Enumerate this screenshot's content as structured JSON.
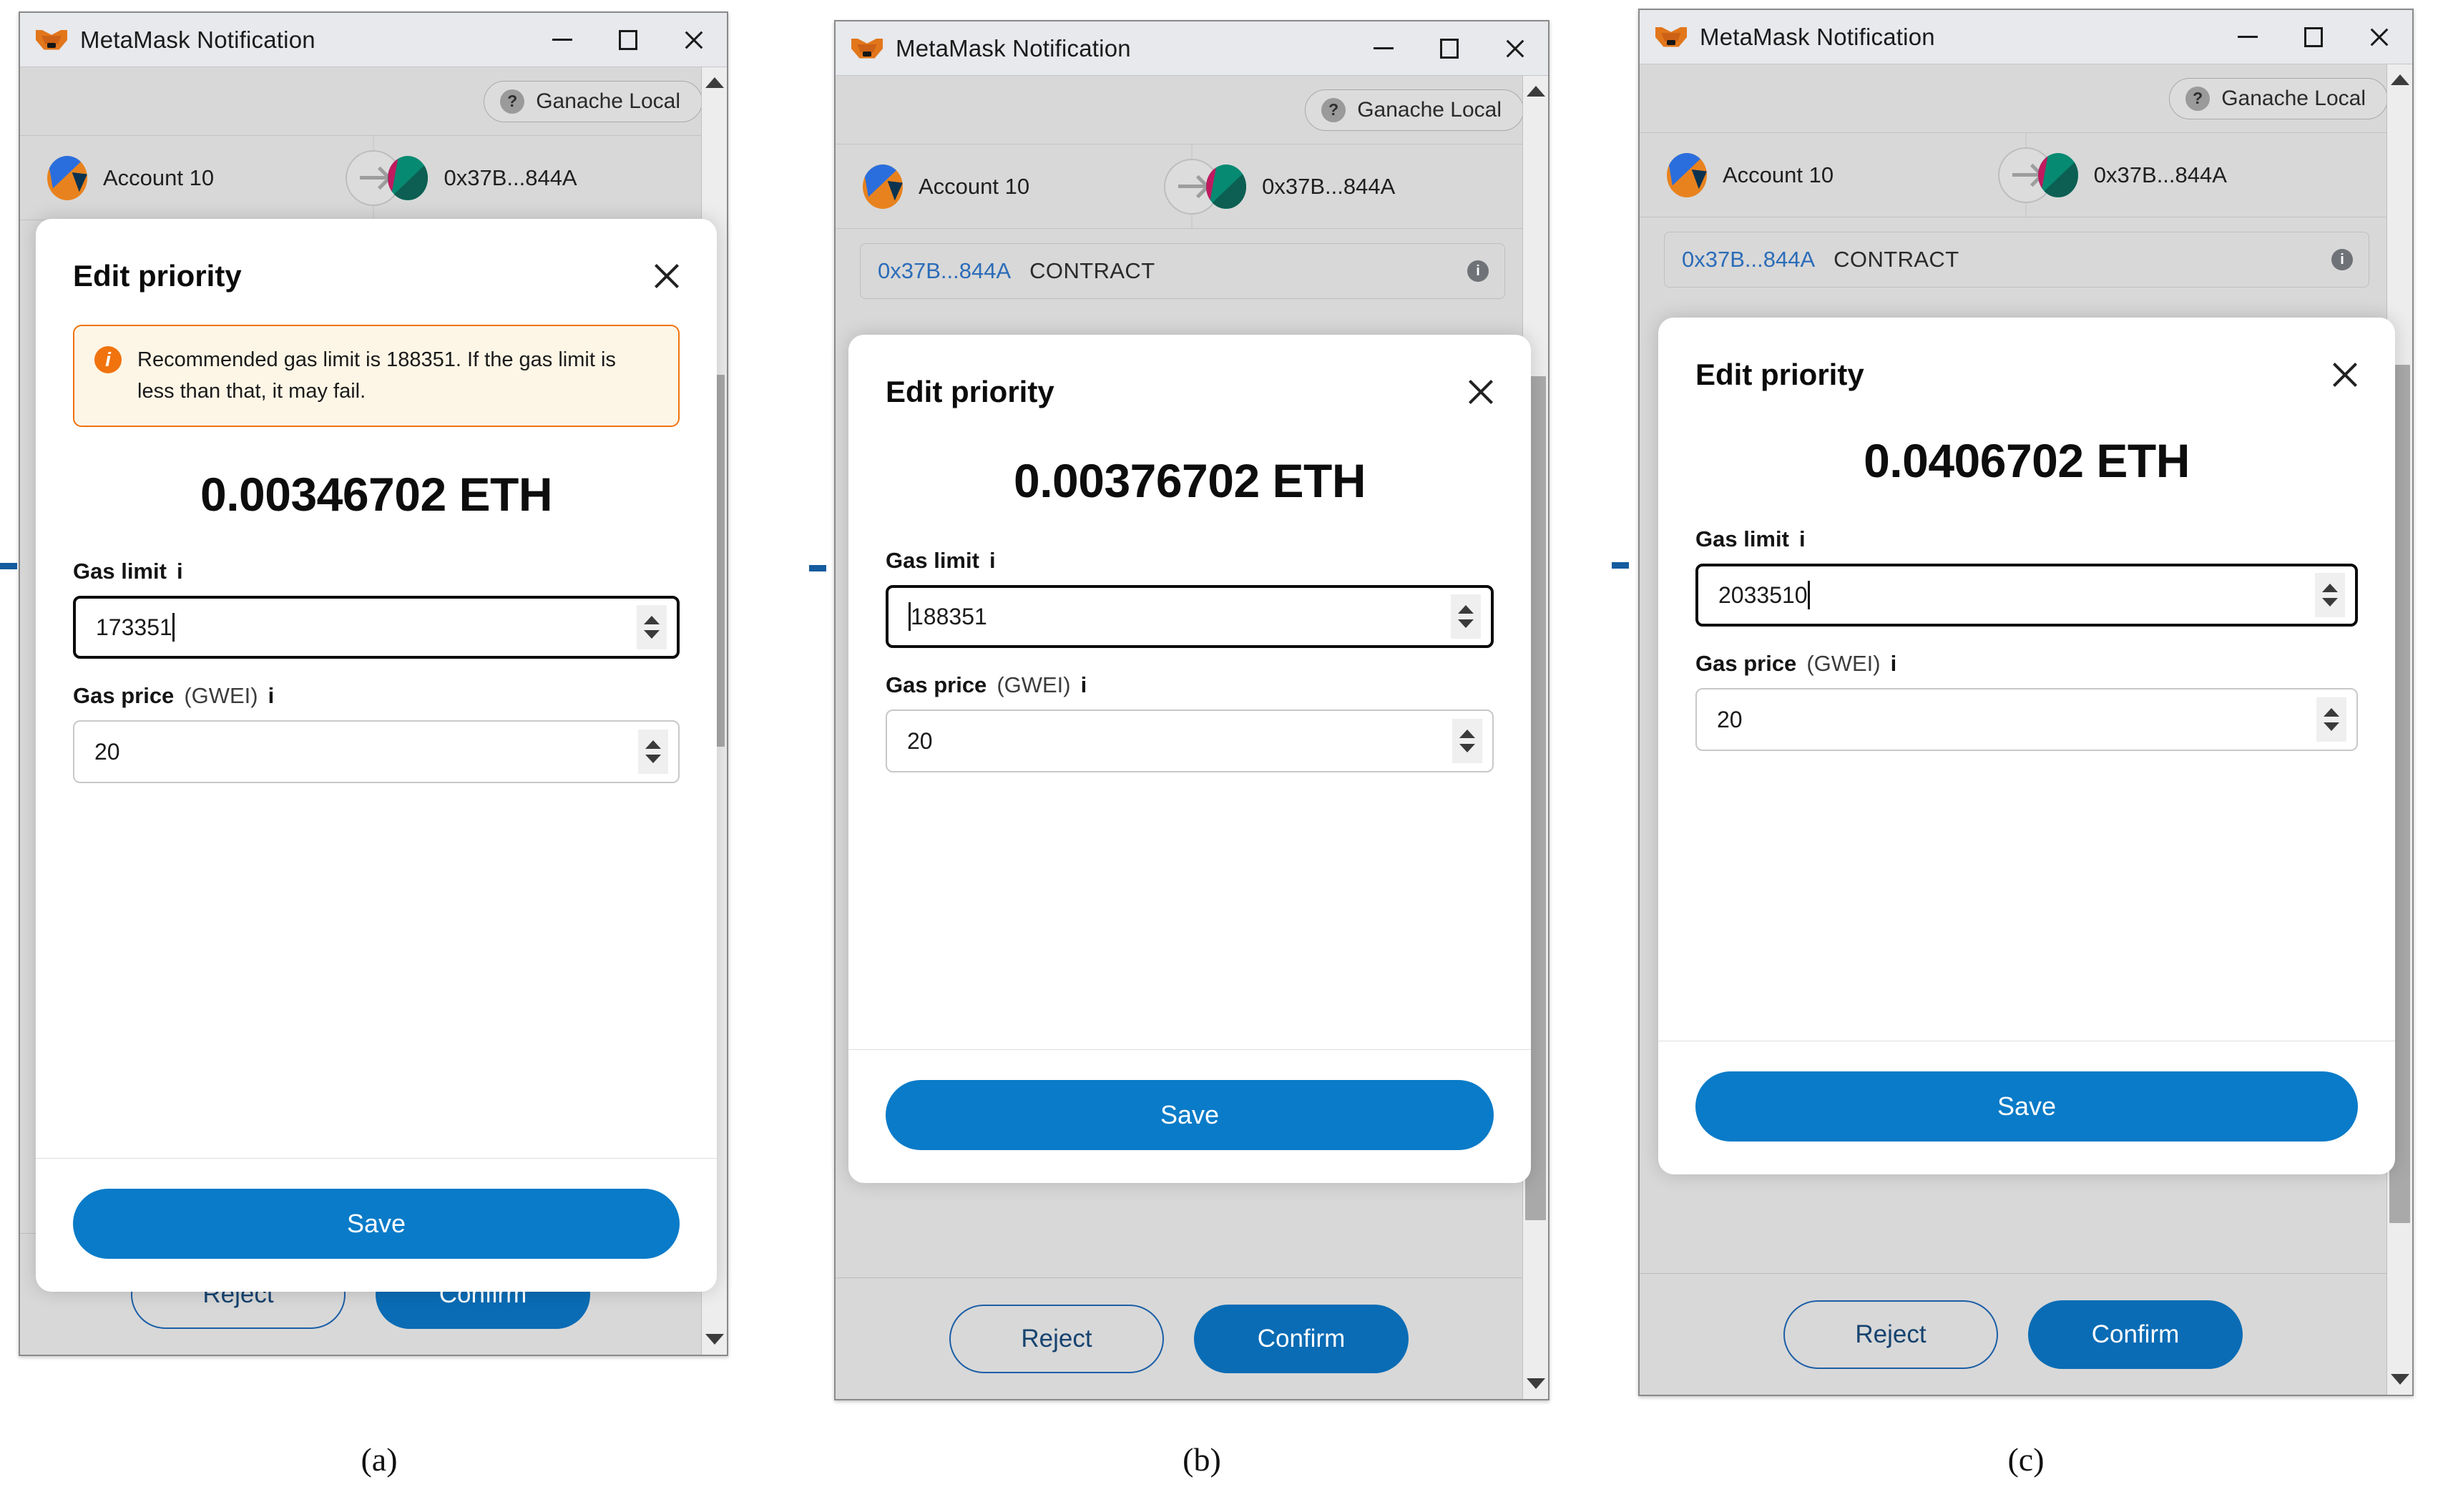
{
  "window": {
    "title": "MetaMask Notification",
    "minimize_label": "–",
    "maximize_label": "▢",
    "close_label": "✕"
  },
  "network": {
    "badge_icon": "question-mark-icon",
    "name": "Ganache Local"
  },
  "transfer": {
    "sender": "Account 10",
    "recipient": "0x37B...844A",
    "arrow_icon": "arrow-right-icon"
  },
  "contract_row": {
    "address": "0x37B...844A",
    "tag": "CONTRACT",
    "info_icon": "info-icon"
  },
  "footer": {
    "reject_label": "Reject",
    "confirm_label": "Confirm"
  },
  "modal": {
    "title": "Edit priority",
    "close_icon": "close-icon",
    "gas_limit_label": "Gas limit",
    "gas_price_label": "Gas price",
    "gas_price_unit": "(GWEI)",
    "info_icon": "info-icon",
    "save_label": "Save",
    "spinner_icon": "stepper-arrows-icon"
  },
  "panels": {
    "a": {
      "caption": "(a)",
      "alert": {
        "icon": "alert-info-icon",
        "text": "Recommended gas limit is 188351. If the gas limit is less than that, it may fail."
      },
      "eth_amount": "0.00346702 ETH",
      "gas_limit_value": "173351",
      "gas_price_value": "20"
    },
    "b": {
      "caption": "(b)",
      "eth_amount": "0.00376702 ETH",
      "gas_limit_value": "188351",
      "gas_price_value": "20"
    },
    "c": {
      "caption": "(c)",
      "eth_amount": "0.0406702 ETH",
      "gas_limit_value": "2033510",
      "gas_price_value": "20"
    }
  },
  "colors": {
    "accent_blue": "#0a7bc8",
    "confirm_blue": "#0a6cb5",
    "alert_orange": "#f0730e",
    "alert_bg": "#fdf6e6",
    "titlebar": "#e7e9ec",
    "app_bg": "#d8d8d8"
  }
}
